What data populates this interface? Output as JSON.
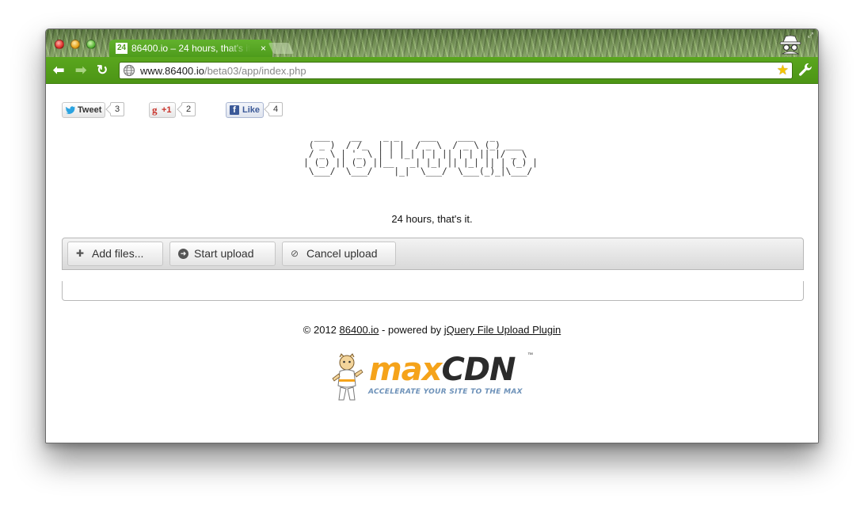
{
  "browser": {
    "tab": {
      "favicon_text": "24",
      "title": "86400.io – 24 hours, that's it.",
      "close_glyph": "×"
    },
    "toolbar": {
      "back_glyph": "⬅",
      "forward_glyph": "➡",
      "reload_glyph": "↻",
      "url_host": "www.86400.io",
      "url_path": "/beta03/app/index.php",
      "bookmark_glyph": "★"
    },
    "colors": {
      "theme_green": "#4e9c1c",
      "bookmark_star": "#f5c400"
    },
    "icons": [
      "incognito-icon",
      "globe-icon",
      "bookmark-star-icon",
      "wrench-icon"
    ]
  },
  "social": {
    "tweet": {
      "label": "Tweet",
      "count": "3"
    },
    "gplus": {
      "label": "+1",
      "count": "2"
    },
    "facebook": {
      "label": "Like",
      "count": "4"
    }
  },
  "logo": {
    "lines": [
      "  ___    __    _ _    ___    ___   _",
      " ( _ )  / /_  | | |  / _ \\  / _ \\ (_) ___",
      " / _ \\ | '_ \\ | | |_| | | || | | || |/ _ \\",
      "| (_) || (_) ||__   _| |_| || |_| || | (_) |",
      " \\___/  \\___/    |_|  \\___/  \\___(_)_|\\___/"
    ]
  },
  "tagline": "24 hours, that's it.",
  "upload": {
    "add_label": "Add files...",
    "start_label": "Start upload",
    "cancel_label": "Cancel upload"
  },
  "footer": {
    "prefix": "© 2012 ",
    "site_link": "86400.io",
    "middle": " - powered by ",
    "plugin_link": "jQuery File Upload Plugin"
  },
  "sponsor": {
    "word_max": "max",
    "word_cdn": "CDN",
    "trademark": "™",
    "tagline": "ACCELERATE YOUR SITE TO THE MAX",
    "colors": {
      "max": "#f5a31a",
      "cdn": "#2b2b2b",
      "tagline": "#6e92b9"
    }
  }
}
